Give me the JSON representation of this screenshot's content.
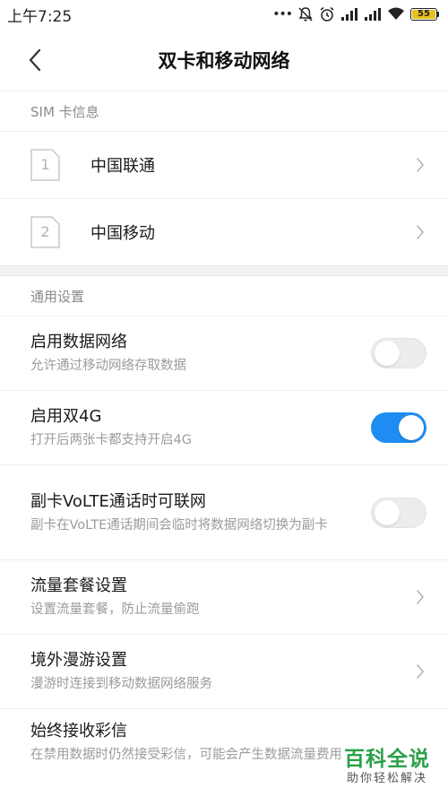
{
  "status_bar": {
    "time": "上午7:25",
    "dots": "•••",
    "battery_level": "55",
    "icons": [
      "mute-bell-icon",
      "alarm-icon",
      "signal-icon",
      "signal-icon",
      "wifi-icon",
      "battery-icon"
    ]
  },
  "header": {
    "title": "双卡和移动网络",
    "back_icon": "chevron-left-icon"
  },
  "sim_section": {
    "label": "SIM 卡信息",
    "cards": [
      {
        "slot": "1",
        "name": "中国联通"
      },
      {
        "slot": "2",
        "name": "中国移动"
      }
    ]
  },
  "general_section": {
    "label": "通用设置",
    "items": [
      {
        "title": "启用数据网络",
        "desc": "允许通过移动网络存取数据",
        "toggle": "off"
      },
      {
        "title": "启用双4G",
        "desc": "打开后两张卡都支持开启4G",
        "toggle": "on"
      },
      {
        "title": "副卡VoLTE通话时可联网",
        "desc": "副卡在VoLTE通话期间会临时将数据网络切换为副卡",
        "toggle": "off"
      },
      {
        "title": "流量套餐设置",
        "desc": "设置流量套餐，防止流量偷跑",
        "toggle": null
      },
      {
        "title": "境外漫游设置",
        "desc": "漫游时连接到移动数据网络服务",
        "toggle": null
      },
      {
        "title": "始终接收彩信",
        "desc": "在禁用数据时仍然接受彩信，可能会产生数据流量费用",
        "toggle": null
      }
    ]
  },
  "colors": {
    "accent": "#1e8cf0",
    "watermark_green": "#2aa048"
  },
  "watermark": {
    "main": "百科全说",
    "sub": "助你轻松解决"
  }
}
